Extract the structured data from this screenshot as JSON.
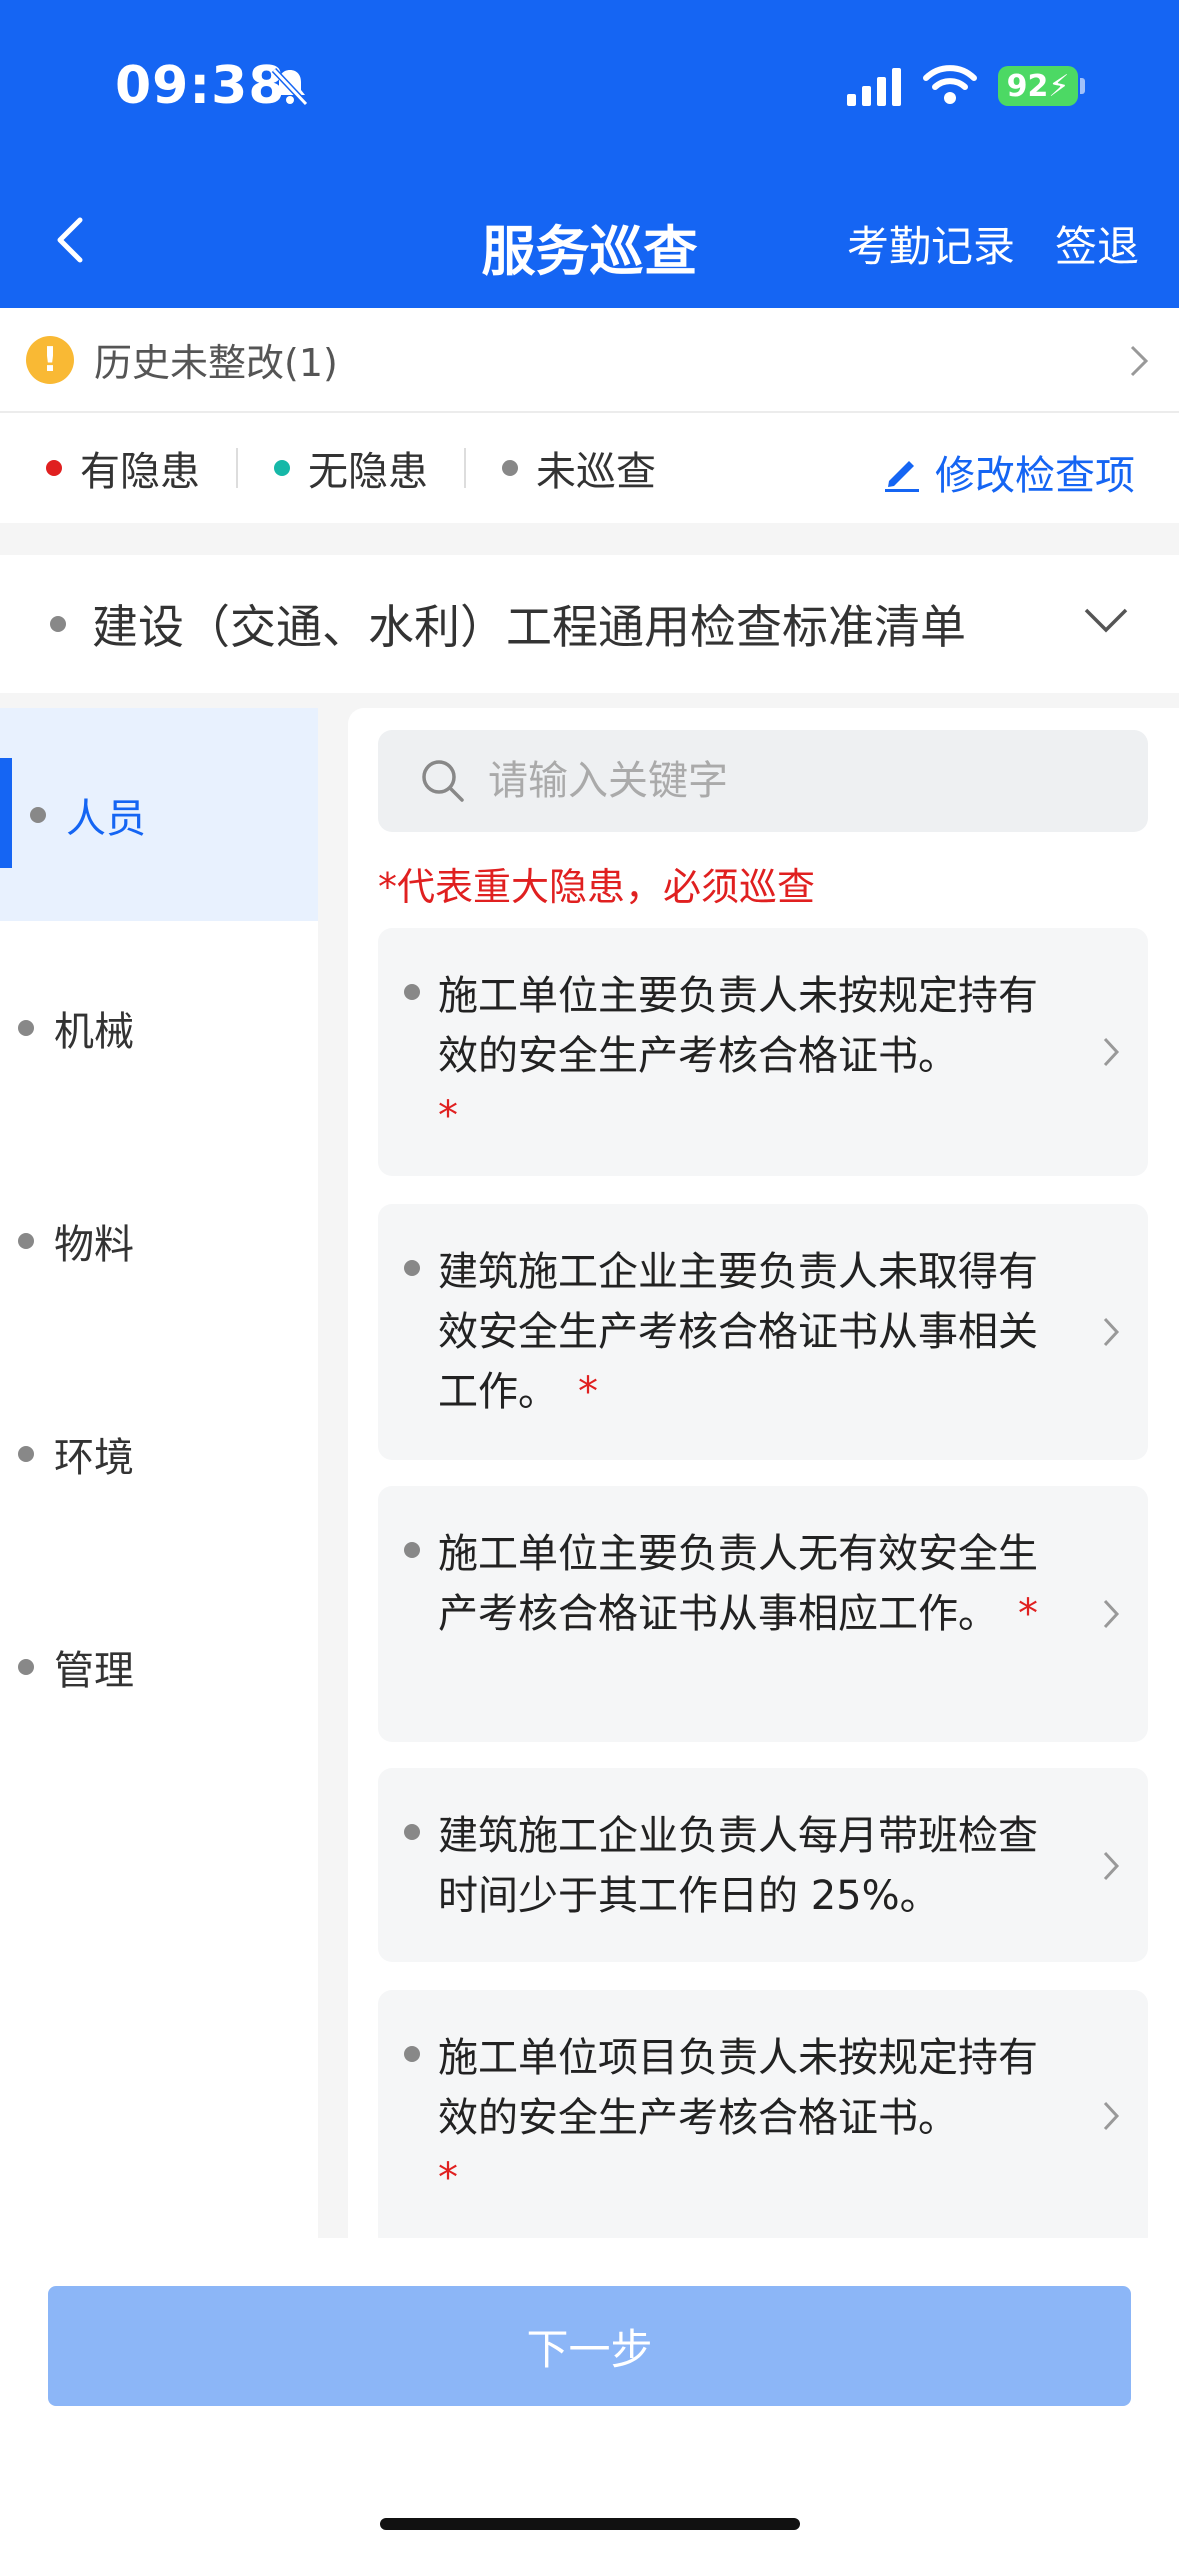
{
  "status_bar": {
    "time": "09:38",
    "battery": "92"
  },
  "nav": {
    "title": "服务巡查",
    "attendance_label": "考勤记录",
    "signout_label": "签退"
  },
  "history": {
    "label": "历史未整改(1)"
  },
  "legend": {
    "has_hazard": "有隐患",
    "no_hazard": "无隐患",
    "not_inspected": "未巡查",
    "edit_label": "修改检查项",
    "colors": {
      "has_hazard": "#e02020",
      "no_hazard": "#16b8a8",
      "not_inspected": "#888888"
    }
  },
  "standard": {
    "title": "建设（交通、水利）工程通用检查标准清单"
  },
  "sidebar": {
    "items": [
      {
        "label": "人员",
        "active": true
      },
      {
        "label": "机械"
      },
      {
        "label": "物料"
      },
      {
        "label": "环境"
      },
      {
        "label": "管理"
      }
    ]
  },
  "search": {
    "placeholder": "请输入关键字",
    "value": ""
  },
  "notice": "*代表重大隐患，必须巡查",
  "items": [
    {
      "text": "施工单位主要负责人未按规定持有效的安全生产考核合格证书。",
      "star": "*"
    },
    {
      "text": "建筑施工企业主要负责人未取得有效安全生产考核合格证书从事相关工作。",
      "star": "*"
    },
    {
      "text": "施工单位主要负责人无有效安全生产考核合格证书从事相应工作。",
      "star": "*"
    },
    {
      "text": "建筑施工企业负责人每月带班检查时间少于其工作日的 25%。",
      "star": ""
    },
    {
      "text": "施工单位项目负责人未按规定持有效的安全生产考核合格证书。",
      "star": "*"
    }
  ],
  "footer": {
    "next_label": "下一步"
  },
  "theme": {
    "primary": "#1565f3",
    "danger": "#e02020"
  }
}
